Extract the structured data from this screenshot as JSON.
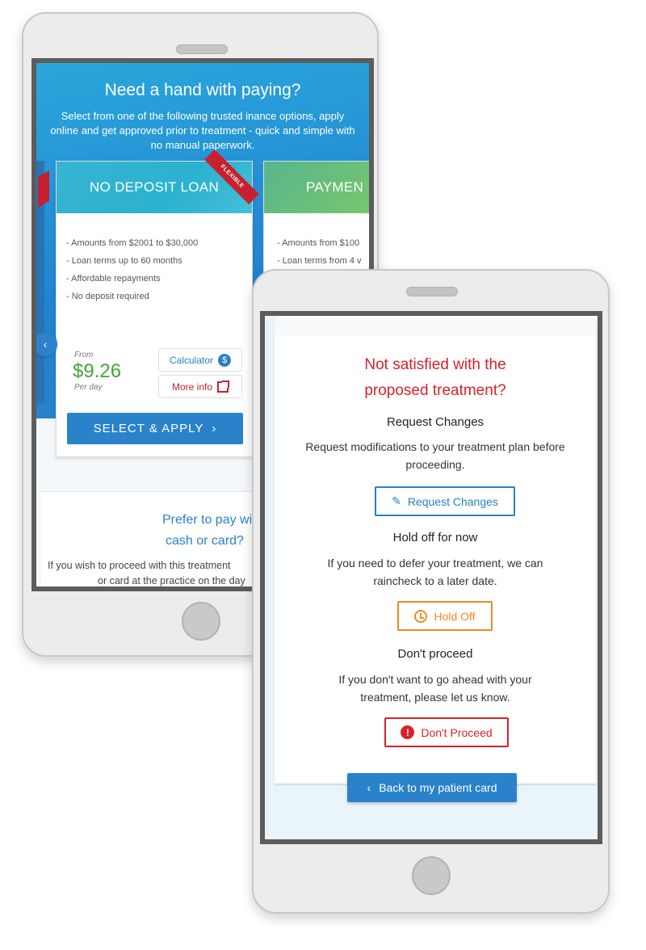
{
  "finance_screen": {
    "title": "Need a hand with paying?",
    "subtitle": "Select from one of the following trusted inance options, apply online and get approved prior to treatment - quick and simple with no manual paperwork.",
    "loan_card": {
      "title": "NO DEPOSIT LOAN",
      "ribbon": "FLEXIBLE",
      "features": [
        "- Amounts from $2001 to $30,000",
        "- Loan terms up to 60 months",
        "- Affordable repayments",
        "- No deposit required"
      ],
      "from_label": "From",
      "price": "$9.26",
      "per_label": "Per day",
      "calculator_label": "Calculator",
      "more_info_label": "More info",
      "apply_label": "SELECT & APPLY"
    },
    "next_card": {
      "title": "PAYMEN",
      "features": [
        "- Amounts from $100",
        "- Loan terms from 4 v"
      ]
    },
    "cash_section": {
      "title_line1": "Prefer to pay with",
      "title_line2": "cash or card?",
      "text_line1": "If you wish to proceed with this treatment",
      "text_line2": "or card at the practice on the day"
    }
  },
  "decision_screen": {
    "title": "Not satisfied with the proposed treatment?",
    "request": {
      "heading": "Request Changes",
      "text": "Request modifications to your treatment plan before proceeding.",
      "button": "Request Changes"
    },
    "hold": {
      "heading": "Hold off for now",
      "text": "If you need to defer your treatment, we can raincheck to a later date.",
      "button": "Hold Off"
    },
    "dont": {
      "heading": "Don't proceed",
      "text": "If you don't want to go ahead with your treatment, please let us know.",
      "button": "Don't Proceed"
    },
    "back_button": "Back to my patient card"
  },
  "colors": {
    "brand_blue": "#2a82cb",
    "danger_red": "#d9212b",
    "warning_orange": "#f08a24",
    "price_green": "#3fa637"
  },
  "icons": [
    "chevron-left-icon",
    "dollar-coin-icon",
    "external-link-icon",
    "chevron-right-icon",
    "pencil-icon",
    "clock-icon",
    "alert-icon"
  ]
}
